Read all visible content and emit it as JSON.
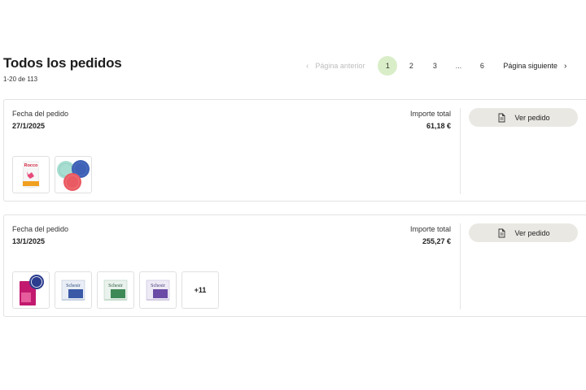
{
  "header": {
    "title": "Todos los pedidos",
    "count": "1-20 de 113"
  },
  "pagination": {
    "prev_label": "Página anterior",
    "pages": [
      "1",
      "2",
      "3"
    ],
    "ellipsis": "...",
    "last_page": "6",
    "current_page": "1",
    "next_label": "Página siguiente"
  },
  "orders": [
    {
      "date_label": "Fecha del pedido",
      "date": "27/1/2025",
      "total_label": "Importe total",
      "total": "61,18 €",
      "view_label": "Ver pedido",
      "products": [
        {
          "name": "Rocco",
          "icon": "food-pouch-icon"
        },
        {
          "name": "",
          "icon": "can-lids-icon"
        }
      ]
    },
    {
      "date_label": "Fecha del pedido",
      "date": "13/1/2025",
      "total_label": "Importe total",
      "total": "255,27 €",
      "view_label": "Ver pedido",
      "products": [
        {
          "name": "",
          "icon": "cat-food-bag-icon"
        },
        {
          "name": "Schesir",
          "icon": "food-can-blue-icon"
        },
        {
          "name": "Schesir",
          "icon": "food-can-green-icon"
        },
        {
          "name": "Schesir",
          "icon": "food-can-purple-icon"
        }
      ],
      "more_items": "+11"
    }
  ],
  "colors": {
    "active_page_bg": "#d9eec8",
    "button_bg": "#eae8e3",
    "card_border": "#e2e2e2"
  }
}
